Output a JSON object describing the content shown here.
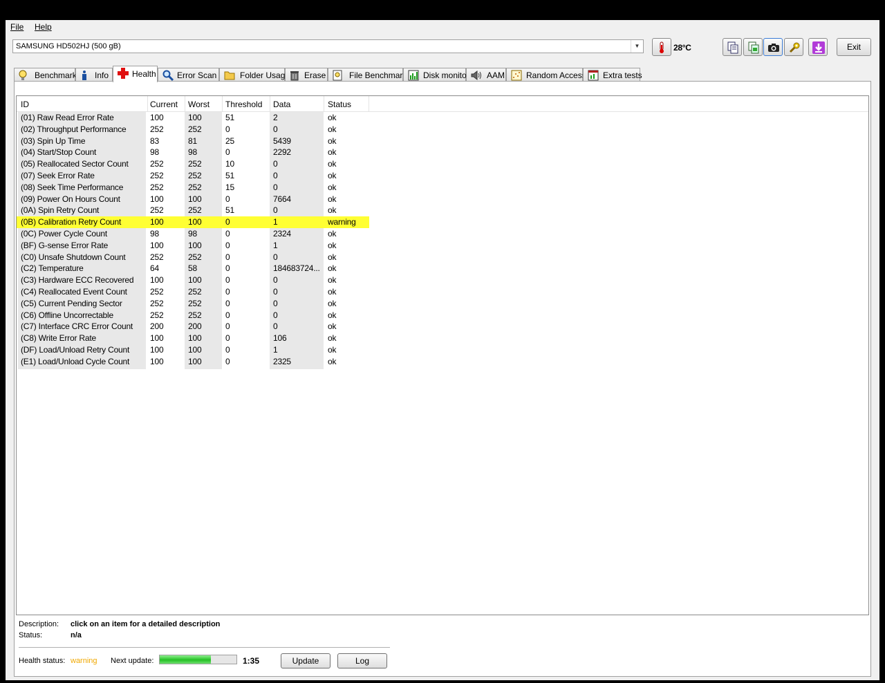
{
  "menu": {
    "file": "File",
    "help": "Help"
  },
  "drive": {
    "selected": "SAMSUNG HD502HJ (500 gB)"
  },
  "temperature": "28°C",
  "exit_label": "Exit",
  "tabs": [
    {
      "label": "Benchmark",
      "icon": "lightbulb-icon"
    },
    {
      "label": "Info",
      "icon": "info-icon"
    },
    {
      "label": "Health",
      "icon": "health-cross-icon"
    },
    {
      "label": "Error Scan",
      "icon": "magnifier-icon"
    },
    {
      "label": "Folder Usage",
      "icon": "folder-icon"
    },
    {
      "label": "Erase",
      "icon": "trash-icon"
    },
    {
      "label": "File Benchmark",
      "icon": "file-benchmark-icon"
    },
    {
      "label": "Disk monitor",
      "icon": "disk-monitor-icon"
    },
    {
      "label": "AAM",
      "icon": "speaker-icon"
    },
    {
      "label": "Random Access",
      "icon": "random-access-icon"
    },
    {
      "label": "Extra tests",
      "icon": "extra-tests-icon"
    }
  ],
  "active_tab": "Health",
  "table": {
    "headers": [
      "ID",
      "Current",
      "Worst",
      "Threshold",
      "Data",
      "Status"
    ],
    "rows": [
      [
        "(01) Raw Read Error Rate",
        "100",
        "100",
        "51",
        "2",
        "ok"
      ],
      [
        "(02) Throughput Performance",
        "252",
        "252",
        "0",
        "0",
        "ok"
      ],
      [
        "(03) Spin Up Time",
        "83",
        "81",
        "25",
        "5439",
        "ok"
      ],
      [
        "(04) Start/Stop Count",
        "98",
        "98",
        "0",
        "2292",
        "ok"
      ],
      [
        "(05) Reallocated Sector Count",
        "252",
        "252",
        "10",
        "0",
        "ok"
      ],
      [
        "(07) Seek Error Rate",
        "252",
        "252",
        "51",
        "0",
        "ok"
      ],
      [
        "(08) Seek Time Performance",
        "252",
        "252",
        "15",
        "0",
        "ok"
      ],
      [
        "(09) Power On Hours Count",
        "100",
        "100",
        "0",
        "7664",
        "ok"
      ],
      [
        "(0A) Spin Retry Count",
        "252",
        "252",
        "51",
        "0",
        "ok"
      ],
      [
        "(0B) Calibration Retry Count",
        "100",
        "100",
        "0",
        "1",
        "warning"
      ],
      [
        "(0C) Power Cycle Count",
        "98",
        "98",
        "0",
        "2324",
        "ok"
      ],
      [
        "(BF) G-sense Error Rate",
        "100",
        "100",
        "0",
        "1",
        "ok"
      ],
      [
        "(C0) Unsafe Shutdown Count",
        "252",
        "252",
        "0",
        "0",
        "ok"
      ],
      [
        "(C2) Temperature",
        "64",
        "58",
        "0",
        "184683724...",
        "ok"
      ],
      [
        "(C3) Hardware ECC Recovered",
        "100",
        "100",
        "0",
        "0",
        "ok"
      ],
      [
        "(C4) Reallocated Event Count",
        "252",
        "252",
        "0",
        "0",
        "ok"
      ],
      [
        "(C5) Current Pending Sector",
        "252",
        "252",
        "0",
        "0",
        "ok"
      ],
      [
        "(C6) Offline Uncorrectable",
        "252",
        "252",
        "0",
        "0",
        "ok"
      ],
      [
        "(C7) Interface CRC Error Count",
        "200",
        "200",
        "0",
        "0",
        "ok"
      ],
      [
        "(C8) Write Error Rate",
        "100",
        "100",
        "0",
        "106",
        "ok"
      ],
      [
        "(DF) Load/Unload Retry Count",
        "100",
        "100",
        "0",
        "1",
        "ok"
      ],
      [
        "(E1) Load/Unload Cycle Count",
        "100",
        "100",
        "0",
        "2325",
        "ok"
      ]
    ],
    "highlight_color": "#ffff33"
  },
  "description": {
    "label": "Description:",
    "value": "click on an item for a detailed description",
    "status_label": "Status:",
    "status_value": "n/a"
  },
  "footer": {
    "health_label": "Health status:",
    "health_value": "warning",
    "health_color": "#f0a800",
    "next_update_label": "Next update:",
    "progress_fraction": 0.67,
    "countdown": "1:35",
    "update_label": "Update",
    "log_label": "Log"
  }
}
